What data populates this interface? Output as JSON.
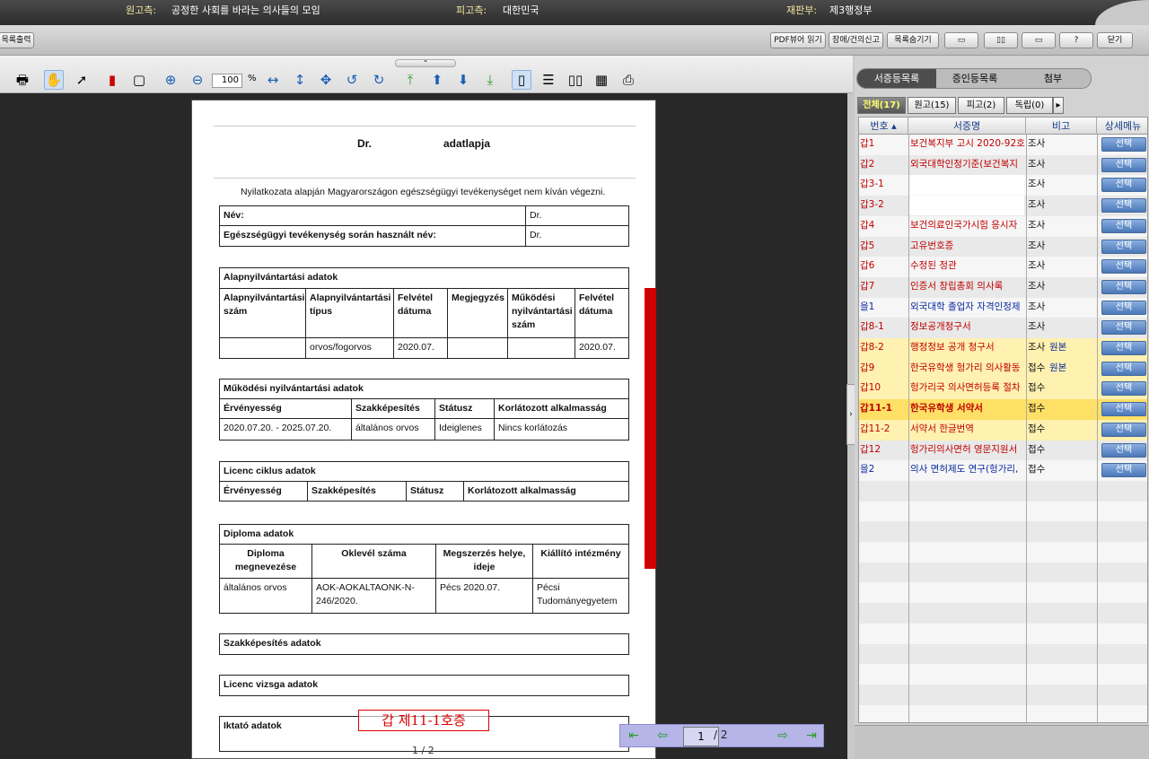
{
  "header": {
    "plaintiff_label": "원고측:",
    "plaintiff": "공정한 사회를 바라는 의사들의 모임",
    "defendant_label": "피고측:",
    "defendant": "대한민국",
    "court_label": "재판부:",
    "court": "제3행정부"
  },
  "toolbar2": {
    "print_list": "목록출력",
    "pdf_viewer": "PDF뷰어 읽기",
    "report": "장애/건의신고",
    "hide_list": "목록숨기기",
    "close": "닫기"
  },
  "viewer": {
    "zoom": "100",
    "zoom_unit": "%",
    "page_current": "1",
    "page_sep": "/ 2",
    "page_footer": "1 / 2",
    "stamp": "갑 제11-1호증"
  },
  "document": {
    "title_left": "Dr.",
    "title_right": "adatlapja",
    "statement": "Nyilatkozata alapján Magyarországon egészségügyi tevékenységet nem kíván végezni.",
    "name_label": "Név:",
    "name_value": "Dr.",
    "used_name_label": "Egészségügyi tevékenység során használt név:",
    "used_name_value": "Dr.",
    "basic": {
      "title": "Alapnyilvántartási adatok",
      "headers": [
        "Alapnyilvántartási szám",
        "Alapnyilvántartási típus",
        "Felvétel dátuma",
        "Megjegyzés",
        "Működési nyilvántartási szám",
        "Felvétel dátuma"
      ],
      "row": [
        "",
        "orvos/fogorvos",
        "2020.07.",
        "",
        "",
        "2020.07."
      ]
    },
    "operating": {
      "title": "Működési nyilvántartási adatok",
      "headers": [
        "Érvényesség",
        "Szakképesítés",
        "Státusz",
        "Korlátozott alkalmasság"
      ],
      "row": [
        "2020.07.20. - 2025.07.20.",
        "általános orvos",
        "Ideiglenes",
        "Nincs korlátozás"
      ]
    },
    "licence": {
      "title": "Licenc ciklus adatok",
      "headers": [
        "Érvényesség",
        "Szakképesítés",
        "Státusz",
        "Korlátozott alkalmasság"
      ]
    },
    "diploma": {
      "title": "Diploma adatok",
      "headers": [
        "Diploma megnevezése",
        "Oklevél száma",
        "Megszerzés helye, ideje",
        "Kiállító intézmény"
      ],
      "row": [
        "általános orvos",
        "AOK-AOKALTAONK-N-246/2020.",
        "Pécs 2020.07.",
        "Pécsi Tudományegyetem"
      ]
    },
    "specialty_title": "Szakképesítés adatok",
    "exam_title": "Licenc vizsga adatok",
    "filing_title": "Iktató adatok"
  },
  "right_panel": {
    "main_tabs": [
      "서증등목록",
      "증인등목록",
      "첨부"
    ],
    "sub_tabs": [
      "전체(17)",
      "원고(15)",
      "피고(2)",
      "독립(0)"
    ],
    "columns": [
      "번호",
      "서증명",
      "비고",
      "상세메뉴"
    ],
    "select_label": "선택",
    "rows": [
      {
        "no": "갑1",
        "name": "보건복지부 고시 2020-92호",
        "note": "조사",
        "extra": ""
      },
      {
        "no": "갑2",
        "name": "외국대학인정기준(보건복지",
        "note": "조사",
        "extra": ""
      },
      {
        "no": "갑3-1",
        "name": "",
        "note": "조사",
        "extra": ""
      },
      {
        "no": "갑3-2",
        "name": "",
        "note": "조사",
        "extra": ""
      },
      {
        "no": "갑4",
        "name": "보건의료인국가시험 응시자",
        "note": "조사",
        "extra": ""
      },
      {
        "no": "갑5",
        "name": "고유번호증",
        "note": "조사",
        "extra": ""
      },
      {
        "no": "갑6",
        "name": "수정된 정관",
        "note": "조사",
        "extra": ""
      },
      {
        "no": "갑7",
        "name": "인증서 창립총회 의사록",
        "note": "조사",
        "extra": ""
      },
      {
        "no": "을1",
        "name": "외국대학 졸업자 자격인정제",
        "note": "조사",
        "extra": ""
      },
      {
        "no": "갑8-1",
        "name": "정보공개청구서",
        "note": "조사",
        "extra": ""
      },
      {
        "no": "갑8-2",
        "name": "행정정보 공개 청구서",
        "note": "조사",
        "extra": "원본"
      },
      {
        "no": "갑9",
        "name": "한국유학생 헝가리 의사활동",
        "note": "접수",
        "extra": "원본"
      },
      {
        "no": "갑10",
        "name": "헝가리국 의사면허등록 절차",
        "note": "접수",
        "extra": ""
      },
      {
        "no": "갑11-1",
        "name": "한국유학생            서약서",
        "note": "접수",
        "extra": ""
      },
      {
        "no": "갑11-2",
        "name": "서약서 한글번역",
        "note": "접수",
        "extra": ""
      },
      {
        "no": "갑12",
        "name": "헝가리의사면허 영문지원서",
        "note": "접수",
        "extra": ""
      },
      {
        "no": "을2",
        "name": "의사 면허제도 연구(헝가리,",
        "note": "접수",
        "extra": ""
      }
    ]
  },
  "colors": {
    "plaintiff_row": "#c00000",
    "defendant_row": "#0a2aa0",
    "highlight_row": "#fff1b0",
    "selected_row": "#ffe066",
    "separator": "#d00000"
  }
}
